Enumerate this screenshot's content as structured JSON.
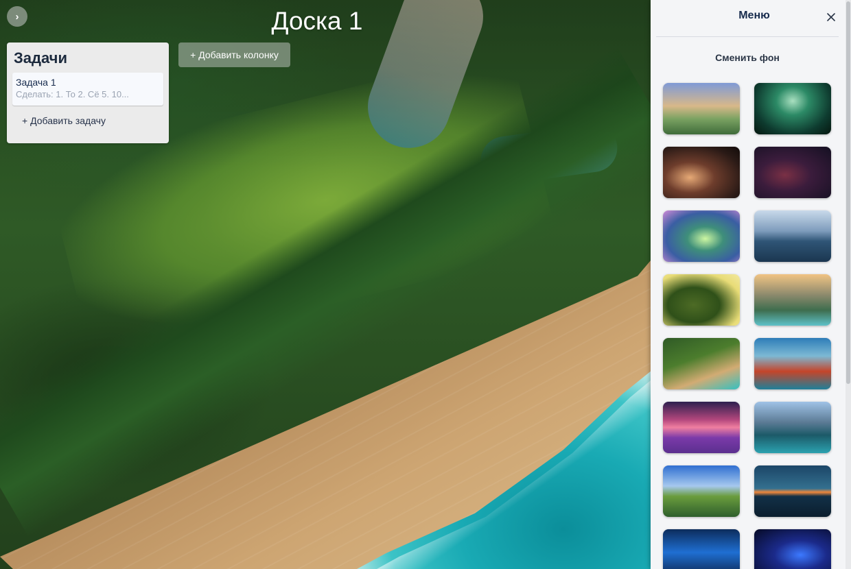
{
  "board": {
    "title": "Доска 1",
    "toggle_label": "›",
    "add_column_label": "+ Добавить колонку"
  },
  "columns": [
    {
      "title": "Задачи",
      "tasks": [
        {
          "title": "Задача 1",
          "description": "Сделать: 1. То 2. Сё 5. 10..."
        }
      ],
      "add_task_label": "+ Добавить задачу"
    }
  ],
  "menu": {
    "title": "Меню",
    "close_icon": "close-icon",
    "change_background_label": "Сменить фон",
    "backgrounds": [
      "fantasy-castle",
      "green-forest-cave",
      "dark-fantasy-knight",
      "dark-crimson-forest",
      "magical-floating-island",
      "crater-lake",
      "giant-tree",
      "waterfall-cliffs",
      "aerial-coast-beach",
      "red-rocks-lake",
      "lavender-field-starry-sky",
      "mountain-lake",
      "meadow-pond",
      "sunset-river",
      "blue-night-moon",
      "blue-planet-horizon"
    ]
  },
  "colors": {
    "panel_bg": "#f4f5f7",
    "column_bg": "#ebebeb",
    "text_dark": "#172b4d",
    "task_description": "#9aa3b2"
  }
}
